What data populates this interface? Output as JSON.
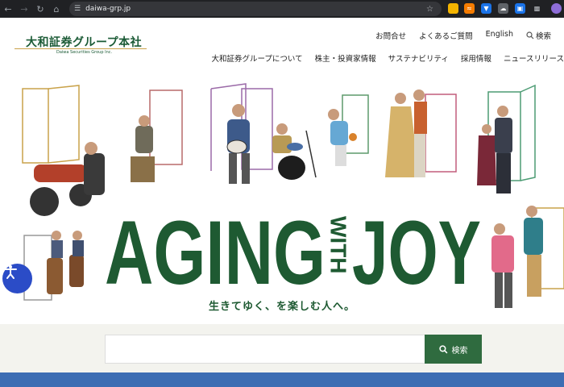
{
  "browser": {
    "url": "daiwa-grp.jp"
  },
  "logo": {
    "main": "大和証券グループ本社",
    "sub": "Daiwa Securities Group Inc."
  },
  "util_nav": [
    "お問合せ",
    "よくあるご質問",
    "English",
    "検索"
  ],
  "main_nav": [
    "大和証券グループについて",
    "株主・投資家情報",
    "サステナビリティ",
    "採用情報",
    "ニュースリリース"
  ],
  "hero": {
    "headline_left": "AGING",
    "headline_with": "WITH",
    "headline_right": "JOY",
    "tagline": "生きてゆく、を楽しむ人へ。",
    "brand_green": "#1e5a32"
  },
  "search": {
    "placeholder": "",
    "button_label": "検索"
  },
  "colors": {
    "accent_green": "#2f6b3f",
    "footer_band_blue": "#3d6db3",
    "accessibility_blue": "#2b4cc7"
  }
}
